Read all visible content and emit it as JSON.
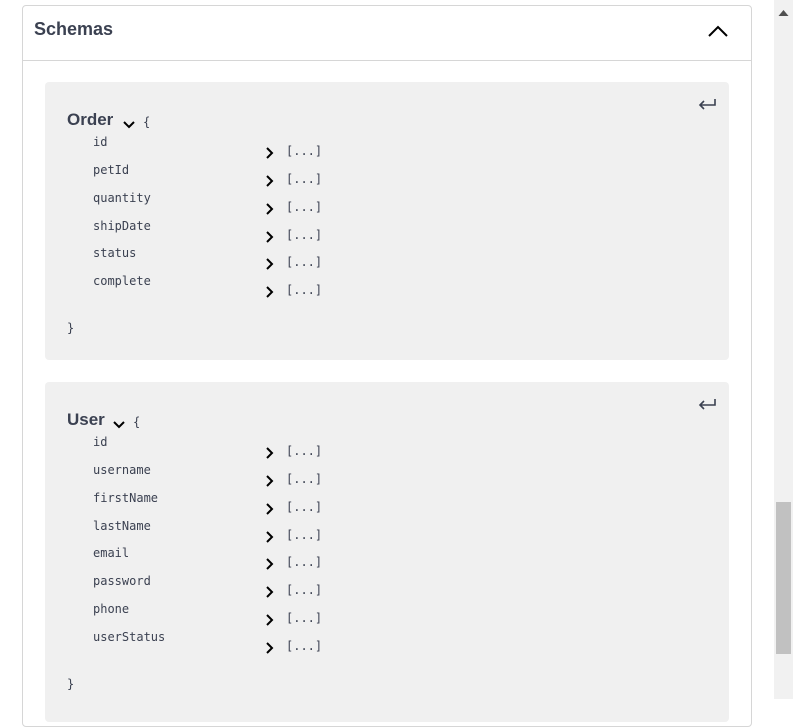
{
  "header": {
    "title": "Schemas"
  },
  "models": [
    {
      "name": "Order",
      "open_brace": "{",
      "close_brace": "}",
      "properties": [
        {
          "name": "id",
          "collapsed": "[...]"
        },
        {
          "name": "petId",
          "collapsed": "[...]"
        },
        {
          "name": "quantity",
          "collapsed": "[...]"
        },
        {
          "name": "shipDate",
          "collapsed": "[...]"
        },
        {
          "name": "status",
          "collapsed": "[...]"
        },
        {
          "name": "complete",
          "collapsed": "[...]"
        }
      ]
    },
    {
      "name": "User",
      "open_brace": "{",
      "close_brace": "}",
      "properties": [
        {
          "name": "id",
          "collapsed": "[...]"
        },
        {
          "name": "username",
          "collapsed": "[...]"
        },
        {
          "name": "firstName",
          "collapsed": "[...]"
        },
        {
          "name": "lastName",
          "collapsed": "[...]"
        },
        {
          "name": "email",
          "collapsed": "[...]"
        },
        {
          "name": "password",
          "collapsed": "[...]"
        },
        {
          "name": "phone",
          "collapsed": "[...]"
        },
        {
          "name": "userStatus",
          "collapsed": "[...]"
        }
      ]
    }
  ],
  "colors": {
    "text": "#3b4151",
    "model_bg": "#f0f0f0",
    "border": "#d6d6d6",
    "scroll_thumb": "#c1c1c1"
  },
  "icons": [
    "chevron-up-icon",
    "chevron-down-icon",
    "return-arrow-icon",
    "chevron-right-icon",
    "scroll-up-arrow-icon"
  ]
}
